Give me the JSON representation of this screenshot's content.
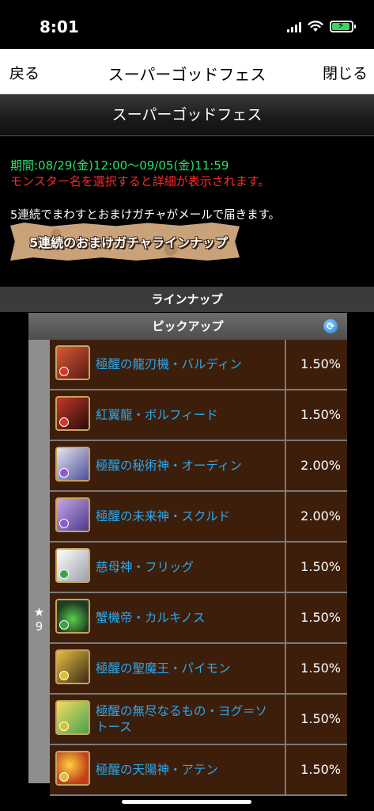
{
  "status": {
    "time": "8:01"
  },
  "nav": {
    "back": "戻る",
    "title": "スーパーゴッドフェス",
    "close": "閉じる"
  },
  "page": {
    "header": "スーパーゴッドフェス",
    "period": "期間:08/29(金)12:00〜09/05(金)11:59",
    "notice": "モンスター名を選択すると詳細が表示されます。",
    "info": "5連続でまわすとおまけガチャがメールで届きます。",
    "banner": "5連続のおまけガチャラインナップ",
    "section": "ラインナップ"
  },
  "pickup": {
    "title": "ピックアップ",
    "rarity_star": "★",
    "rarity_value": "9",
    "monsters": [
      {
        "name": "極醒の龍刃機・バルディン",
        "rate": "1.50%",
        "icon": "red-dragon-machine",
        "color": "#b5372a"
      },
      {
        "name": "紅翼龍・ボルフィード",
        "rate": "1.50%",
        "icon": "red-wing-dragon",
        "color": "#8a2a22"
      },
      {
        "name": "極醒の秘術神・オーディン",
        "rate": "2.00%",
        "icon": "odin",
        "color": "#5f6fb0"
      },
      {
        "name": "極醒の未来神・スクルド",
        "rate": "2.00%",
        "icon": "skuld",
        "color": "#7a62b8"
      },
      {
        "name": "慈母神・フリッグ",
        "rate": "1.50%",
        "icon": "frigg",
        "color": "#dcdcdc"
      },
      {
        "name": "蟹機帝・カルキノス",
        "rate": "1.50%",
        "icon": "karkinos",
        "color": "#3a8a3c"
      },
      {
        "name": "極醒の聖魔王・パイモン",
        "rate": "1.50%",
        "icon": "paimon",
        "color": "#c8a030"
      },
      {
        "name": "極醒の無尽なるもの・ヨグ＝ソトース",
        "rate": "1.50%",
        "icon": "yog-sothoth",
        "color": "#d4c238"
      },
      {
        "name": "極醒の天陽神・アテン",
        "rate": "1.50%",
        "icon": "aten",
        "color": "#e07a20"
      }
    ]
  }
}
